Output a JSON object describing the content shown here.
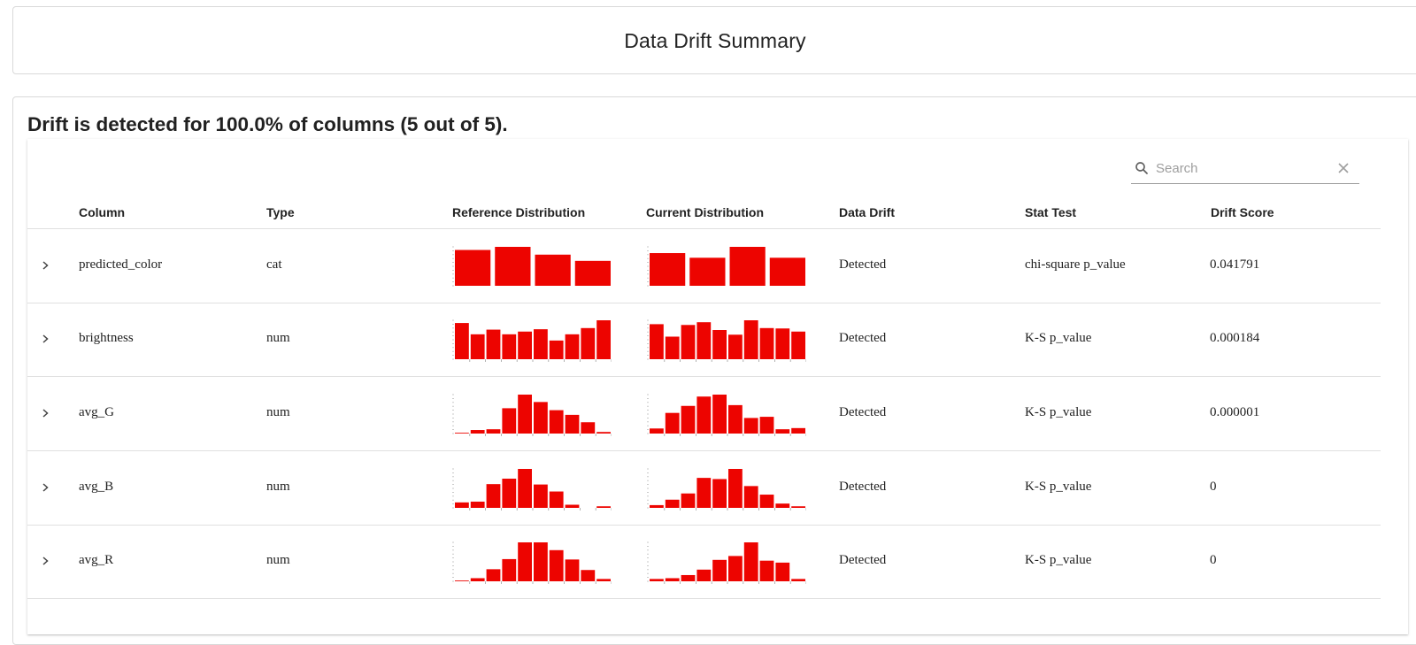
{
  "header": {
    "title": "Data Drift Summary"
  },
  "summary": {
    "headline": "Drift is detected for 100.0% of columns (5 out of 5)."
  },
  "search": {
    "placeholder": "Search",
    "value": ""
  },
  "columns": {
    "column": "Column",
    "type": "Type",
    "reference": "Reference Distribution",
    "current": "Current Distribution",
    "drift": "Data Drift",
    "stat_test": "Stat Test",
    "score": "Drift Score"
  },
  "colors": {
    "bar": "#ed0400"
  },
  "rows": [
    {
      "column": "predicted_color",
      "type": "cat",
      "drift": "Detected",
      "stat_test": "chi-square p_value",
      "score": "0.041791"
    },
    {
      "column": "brightness",
      "type": "num",
      "drift": "Detected",
      "stat_test": "K-S p_value",
      "score": "0.000184"
    },
    {
      "column": "avg_G",
      "type": "num",
      "drift": "Detected",
      "stat_test": "K-S p_value",
      "score": "0.000001"
    },
    {
      "column": "avg_B",
      "type": "num",
      "drift": "Detected",
      "stat_test": "K-S p_value",
      "score": "0"
    },
    {
      "column": "avg_R",
      "type": "num",
      "drift": "Detected",
      "stat_test": "K-S p_value",
      "score": "0"
    }
  ],
  "chart_data": [
    {
      "type": "bar",
      "title": "",
      "series": [
        {
          "name": "",
          "values": [
            0.92,
            1.0,
            0.8,
            0.64
          ]
        }
      ],
      "row": "predicted_color",
      "kind": "reference"
    },
    {
      "type": "bar",
      "title": "",
      "series": [
        {
          "name": "",
          "values": [
            0.84,
            0.72,
            1.0,
            0.72
          ]
        }
      ],
      "row": "predicted_color",
      "kind": "current"
    },
    {
      "type": "bar",
      "title": "",
      "series": [
        {
          "name": "",
          "values": [
            0.93,
            0.64,
            0.76,
            0.64,
            0.71,
            0.77,
            0.48,
            0.64,
            0.8,
            1.0
          ]
        }
      ],
      "row": "brightness",
      "kind": "reference"
    },
    {
      "type": "bar",
      "title": "",
      "series": [
        {
          "name": "",
          "values": [
            0.9,
            0.58,
            0.88,
            0.95,
            0.75,
            0.63,
            1.0,
            0.8,
            0.79,
            0.71
          ]
        }
      ],
      "row": "brightness",
      "kind": "current"
    },
    {
      "type": "bar",
      "title": "",
      "series": [
        {
          "name": "",
          "values": [
            0.02,
            0.09,
            0.11,
            0.65,
            1.0,
            0.81,
            0.6,
            0.48,
            0.29,
            0.04
          ]
        }
      ],
      "row": "avg_G",
      "kind": "reference"
    },
    {
      "type": "bar",
      "title": "",
      "series": [
        {
          "name": "",
          "values": [
            0.13,
            0.53,
            0.71,
            0.95,
            1.0,
            0.73,
            0.4,
            0.43,
            0.11,
            0.14
          ]
        }
      ],
      "row": "avg_G",
      "kind": "current"
    },
    {
      "type": "bar",
      "title": "",
      "series": [
        {
          "name": "",
          "values": [
            0.14,
            0.16,
            0.61,
            0.75,
            1.0,
            0.6,
            0.42,
            0.08,
            0.0,
            0.04
          ]
        }
      ],
      "row": "avg_B",
      "kind": "reference"
    },
    {
      "type": "bar",
      "title": "",
      "series": [
        {
          "name": "",
          "values": [
            0.07,
            0.21,
            0.37,
            0.77,
            0.74,
            1.0,
            0.56,
            0.34,
            0.11,
            0.04
          ]
        }
      ],
      "row": "avg_B",
      "kind": "current"
    },
    {
      "type": "bar",
      "title": "",
      "series": [
        {
          "name": "",
          "values": [
            0.02,
            0.08,
            0.31,
            0.57,
            1.0,
            1.0,
            0.8,
            0.56,
            0.29,
            0.06
          ]
        }
      ],
      "row": "avg_R",
      "kind": "reference"
    },
    {
      "type": "bar",
      "title": "",
      "series": [
        {
          "name": "",
          "values": [
            0.06,
            0.08,
            0.16,
            0.3,
            0.55,
            0.65,
            1.0,
            0.53,
            0.48,
            0.06
          ]
        }
      ],
      "row": "avg_R",
      "kind": "current"
    }
  ]
}
